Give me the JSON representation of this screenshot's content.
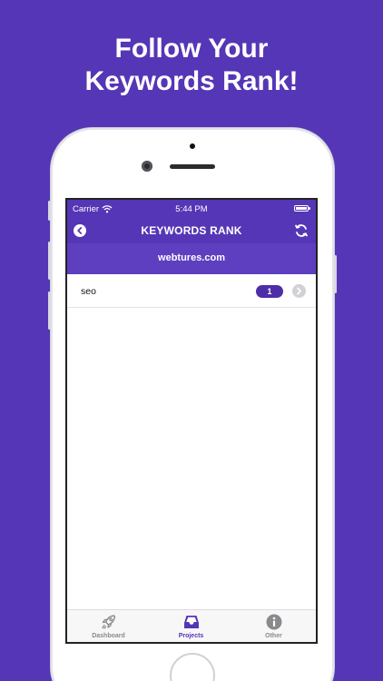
{
  "promo": {
    "line1": "Follow Your",
    "line2": "Keywords Rank!"
  },
  "status_bar": {
    "carrier": "Carrier",
    "time": "5:44 PM"
  },
  "nav": {
    "title": "KEYWORDS RANK"
  },
  "project": {
    "domain": "webtures.com"
  },
  "keywords": [
    {
      "keyword": "seo",
      "rank": "1"
    }
  ],
  "tabs": [
    {
      "label": "Dashboard",
      "icon": "rocket-icon"
    },
    {
      "label": "Projects",
      "icon": "inbox-tray-icon",
      "active": true
    },
    {
      "label": "Other",
      "icon": "info-icon"
    }
  ],
  "colors": {
    "brand": "#5536b6",
    "badge": "#4e2ea8",
    "inactive": "#8a8a8e"
  }
}
